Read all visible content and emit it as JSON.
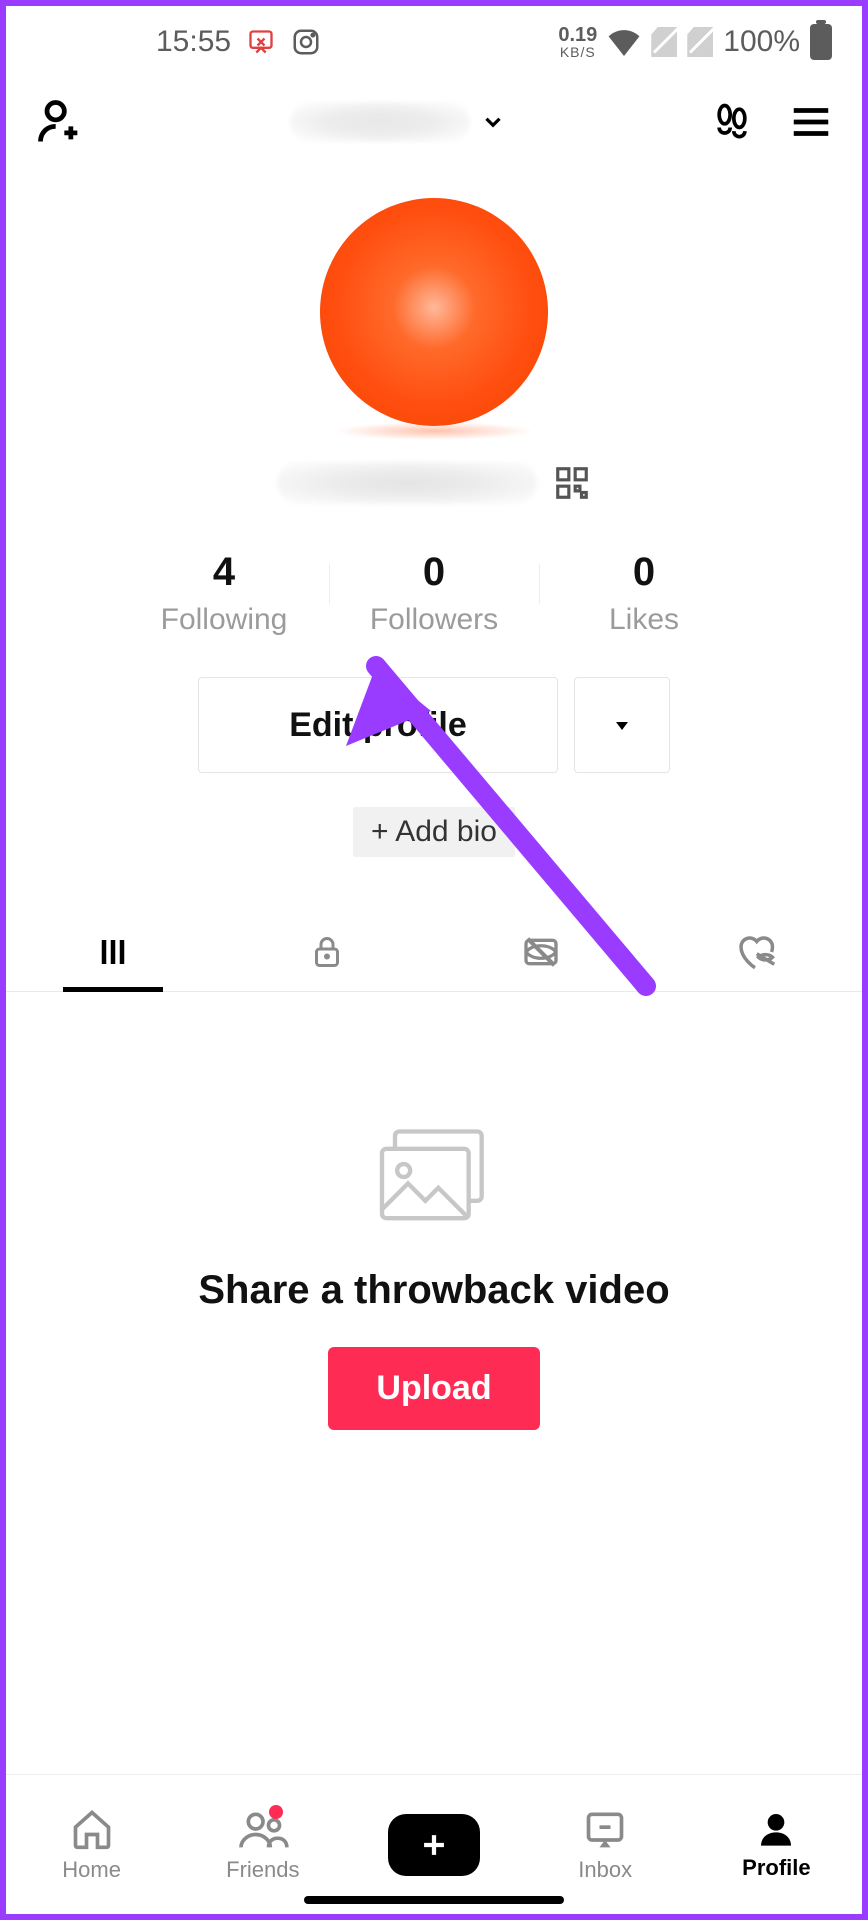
{
  "status": {
    "time": "15:55",
    "kbs_value": "0.19",
    "kbs_unit": "KB/S",
    "battery": "100%"
  },
  "header": {
    "username_hidden": true
  },
  "stats": {
    "following": {
      "count": "4",
      "label": "Following"
    },
    "followers": {
      "count": "0",
      "label": "Followers"
    },
    "likes": {
      "count": "0",
      "label": "Likes"
    }
  },
  "buttons": {
    "edit_profile": "Edit profile",
    "add_bio": "+ Add bio"
  },
  "empty": {
    "title": "Share a throwback video",
    "upload": "Upload"
  },
  "nav": {
    "home": "Home",
    "friends": "Friends",
    "inbox": "Inbox",
    "profile": "Profile"
  }
}
